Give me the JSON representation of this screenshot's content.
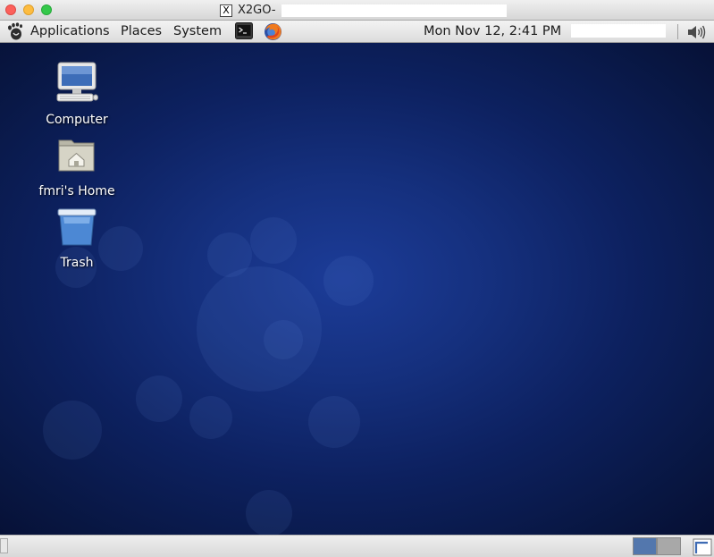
{
  "window": {
    "title": "X2GO-",
    "app_icon": "x-window-icon",
    "x_glyph": "X"
  },
  "panel": {
    "menus": [
      {
        "label": "Applications"
      },
      {
        "label": "Places"
      },
      {
        "label": "System"
      }
    ],
    "launchers": [
      {
        "name": "terminal-icon"
      },
      {
        "name": "firefox-icon"
      }
    ],
    "clock": "Mon Nov 12,  2:41 PM",
    "volume_icon": "volume-icon"
  },
  "desktop": {
    "icons": [
      {
        "label": "Computer",
        "icon": "computer-icon"
      },
      {
        "label": "fmri's Home",
        "icon": "home-folder-icon"
      },
      {
        "label": "Trash",
        "icon": "trash-icon"
      }
    ]
  },
  "bottom_panel": {
    "workspaces": [
      {
        "name": "workspace-1",
        "active": true,
        "color": "#5377ad"
      },
      {
        "name": "workspace-2",
        "active": false,
        "color": "#a8a8a8"
      }
    ]
  },
  "colors": {
    "desktop_center": "#1c3c98",
    "desktop_edge": "#060f33",
    "close": "#fc605b",
    "minimize": "#fdbc40",
    "zoom": "#34c84a"
  }
}
